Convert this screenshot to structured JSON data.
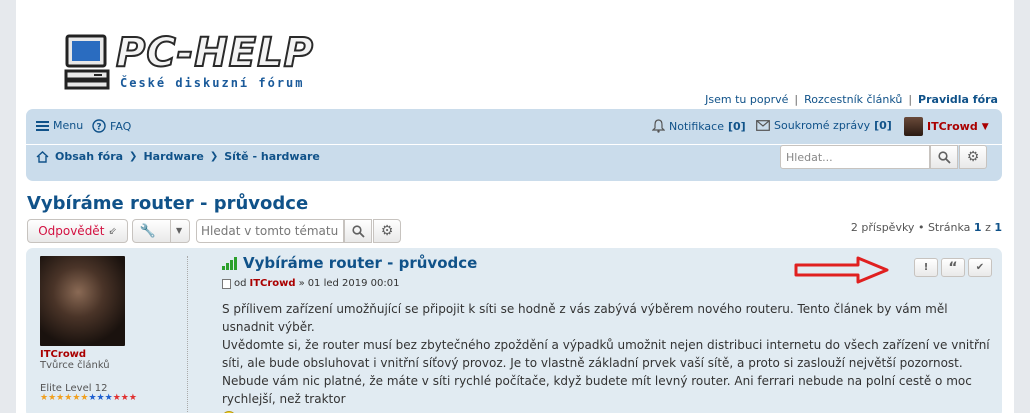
{
  "header": {
    "logo_title": "PC-HELP",
    "logo_subtitle": "České diskuzní fórum",
    "toplinks": [
      "Jsem tu poprvé",
      "Rozcestník článků",
      "Pravidla fóra"
    ]
  },
  "navbar": {
    "menu_label": "Menu",
    "faq_label": "FAQ",
    "notifications_label": "Notifikace",
    "notifications_count": "[0]",
    "pm_label": "Soukromé zprávy",
    "pm_count": "[0]",
    "username": "ITCrowd",
    "breadcrumb": [
      "Obsah fóra",
      "Hardware",
      "Sítě - hardware"
    ],
    "search_placeholder": "Hledat..."
  },
  "topic": {
    "title": "Vybíráme router - průvodce",
    "reply_label": "Odpovědět",
    "search_placeholder": "Hledat v tomto tématu",
    "posts_count": "2 příspěvky",
    "page_label": "Stránka",
    "page_current": "1",
    "page_of": "z",
    "page_total": "1"
  },
  "post": {
    "title": "Vybíráme router - průvodce",
    "author_prefix": "od",
    "author": "ITCrowd",
    "date": "01 led 2019 00:01",
    "profile_name": "ITCrowd",
    "profile_rank": "Tvůrce článků",
    "profile_level": "Elite Level 12",
    "content_line1": "S přílivem zařízení umožňující se připojit k síti se hodně z vás zabývá výběrem nového routeru. Tento článek by vám měl usnadnit výběr.",
    "content_line2": "Uvědomte si, že router musí bez zbytečného zpoždění a výpadků umožnit nejen distribuci internetu do všech zařízení ve vnitřní síti, ale bude obsluhovat i vnitřní síťový provoz. Je to vlastně základní prvek vaší sítě, a proto si zaslouží největší pozornost. Nebude vám nic platné, že máte v síti rychlé počítače, když budete mít levný router. Ani ferrari nebude na polní cestě o moc rychlejší, než traktor",
    "report_label": "!",
    "quote_label": "“",
    "accept_label": "✔"
  },
  "colors": {
    "link": "#105289",
    "username_red": "#aa0000",
    "navbar_bg": "#cadceb",
    "post_bg": "#e1ebf2",
    "reply_text": "#d31141"
  }
}
